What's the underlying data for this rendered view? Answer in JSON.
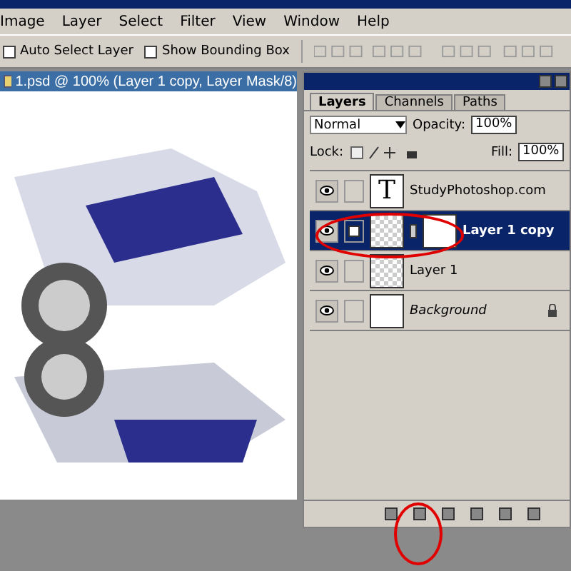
{
  "menu": [
    "Image",
    "Layer",
    "Select",
    "Filter",
    "View",
    "Window",
    "Help"
  ],
  "options": [
    {
      "label": "Auto Select Layer",
      "checked": false
    },
    {
      "label": "Show Bounding Box",
      "checked": false
    }
  ],
  "document": {
    "title": "1.psd @ 100% (Layer 1 copy, Layer Mask/8)"
  },
  "layers_panel": {
    "tabs": [
      {
        "label": "Layers",
        "selected": true
      },
      {
        "label": "Channels",
        "selected": false
      },
      {
        "label": "Paths",
        "selected": false
      }
    ],
    "blend_mode": "Normal",
    "opacity_label": "Opacity:",
    "opacity": "100%",
    "lock_label": "Lock:",
    "fill_label": "Fill:",
    "fill": "100%",
    "layers": [
      {
        "name": "StudyPhotoshop.com",
        "kind": "text",
        "thumb": "T",
        "visible": true,
        "selected": false,
        "mask": false,
        "locked": false
      },
      {
        "name": "Layer 1 copy",
        "kind": "image",
        "visible": true,
        "selected": true,
        "mask": true,
        "locked": false
      },
      {
        "name": "Layer 1",
        "kind": "image",
        "visible": true,
        "selected": false,
        "mask": false,
        "locked": false
      },
      {
        "name": "Background",
        "kind": "background",
        "visible": true,
        "selected": false,
        "mask": false,
        "locked": true
      }
    ]
  }
}
